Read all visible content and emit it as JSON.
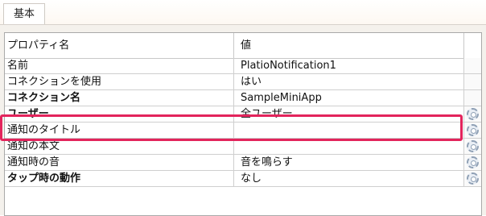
{
  "tab": {
    "label": "基本"
  },
  "grid": {
    "headers": {
      "property": "プロパティ名",
      "value": "値"
    },
    "rows": [
      {
        "name": "名前",
        "value": "PlatioNotification1",
        "bold": false,
        "has_button": false
      },
      {
        "name": "コネクションを使用",
        "value": "はい",
        "bold": false,
        "has_button": false
      },
      {
        "name": "コネクション名",
        "value": "SampleMiniApp",
        "bold": true,
        "has_button": false
      },
      {
        "name": "ユーザー",
        "value": "全ユーザー",
        "bold": true,
        "has_button": true
      },
      {
        "name": "通知のタイトル",
        "value": "",
        "bold": false,
        "has_button": true
      },
      {
        "name": "通知の本文",
        "value": "",
        "bold": false,
        "has_button": true
      },
      {
        "name": "通知時の音",
        "value": "音を鳴らす",
        "bold": false,
        "has_button": true
      },
      {
        "name": "タップ時の動作",
        "value": "なし",
        "bold": true,
        "has_button": true
      }
    ]
  },
  "highlight": {
    "color": "#e3245c",
    "row": "ユーザー"
  },
  "icons": {
    "row_button": "gear-icon"
  }
}
